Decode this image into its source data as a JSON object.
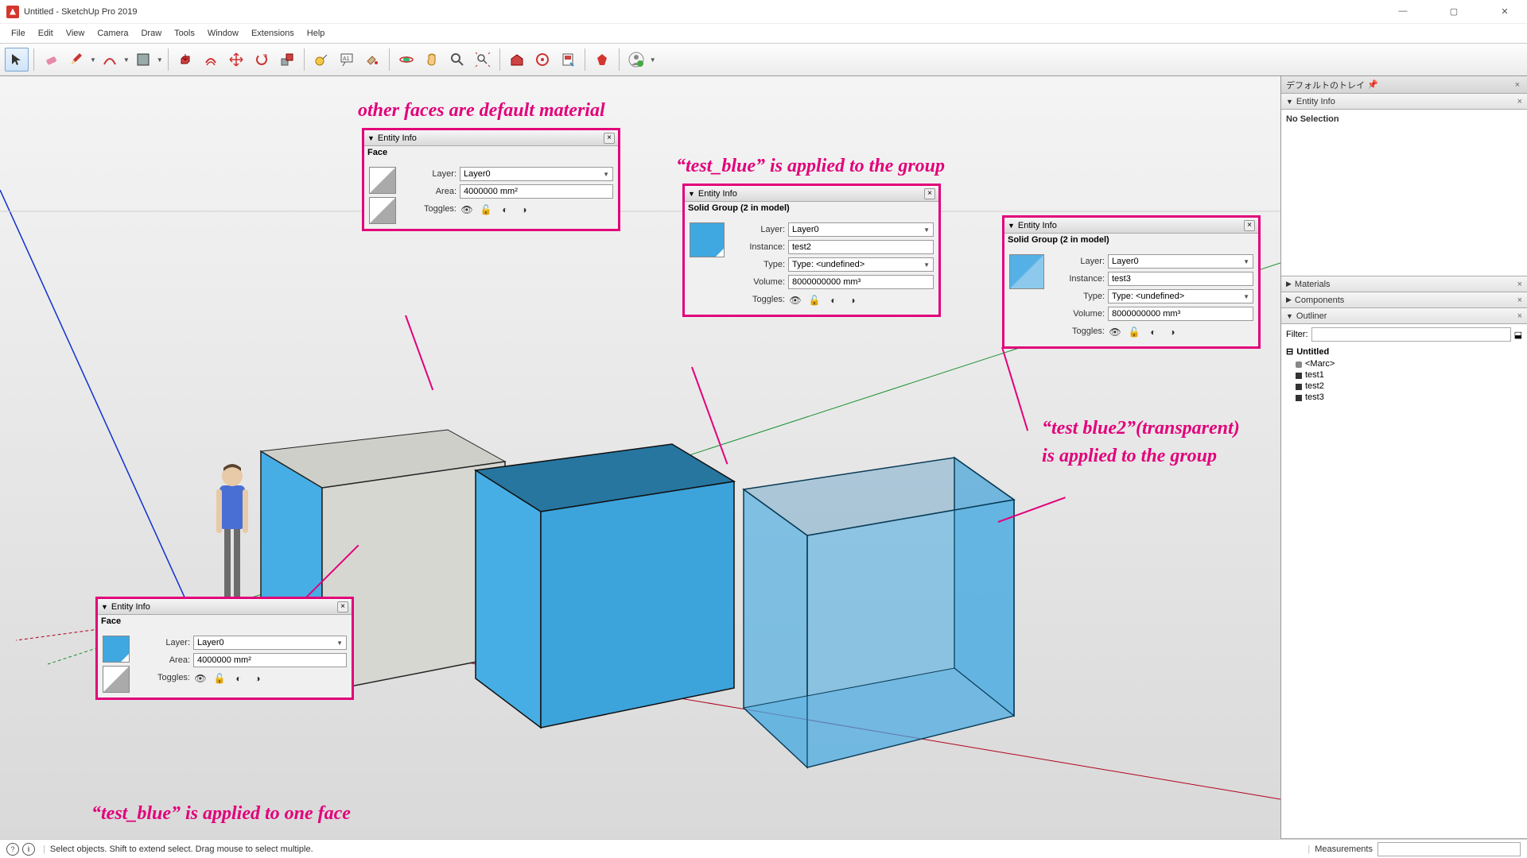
{
  "title": "Untitled - SketchUp Pro 2019",
  "menu": [
    "File",
    "Edit",
    "View",
    "Camera",
    "Draw",
    "Tools",
    "Window",
    "Extensions",
    "Help"
  ],
  "statusbar": {
    "hint": "Select objects. Shift to extend select. Drag mouse to select multiple.",
    "measure_label": "Measurements"
  },
  "tray": {
    "title": "デフォルトのトレイ",
    "entity_info": "Entity Info",
    "no_selection": "No Selection",
    "materials": "Materials",
    "components": "Components",
    "outliner": "Outliner",
    "filter_label": "Filter:",
    "root": "Untitled",
    "items": [
      {
        "label": "<Marc>",
        "cls": "marc"
      },
      {
        "label": "test1",
        "cls": ""
      },
      {
        "label": "test2",
        "cls": ""
      },
      {
        "label": "test3",
        "cls": ""
      }
    ]
  },
  "annotations": {
    "top": "other faces are default material",
    "right1": "“test_blue” is applied to the group",
    "right2a": "“test blue2”(transparent)",
    "right2b": "is applied to the group",
    "bottom": "“test_blue” is applied to one face"
  },
  "ei_a": {
    "title": "Entity Info",
    "header": "Face",
    "layer_label": "Layer:",
    "layer": "Layer0",
    "area_label": "Area:",
    "area": "4000000 mm²",
    "toggles_label": "Toggles:"
  },
  "ei_b": {
    "title": "Entity Info",
    "header": "Face",
    "layer_label": "Layer:",
    "layer": "Layer0",
    "area_label": "Area:",
    "area": "4000000 mm²",
    "toggles_label": "Toggles:"
  },
  "ei_c": {
    "title": "Entity Info",
    "header": "Solid Group (2 in model)",
    "layer_label": "Layer:",
    "layer": "Layer0",
    "instance_label": "Instance:",
    "instance": "test2",
    "type_label": "Type:",
    "type": "Type: <undefined>",
    "volume_label": "Volume:",
    "volume": "8000000000 mm³",
    "toggles_label": "Toggles:"
  },
  "ei_d": {
    "title": "Entity Info",
    "header": "Solid Group (2 in model)",
    "layer_label": "Layer:",
    "layer": "Layer0",
    "instance_label": "Instance:",
    "instance": "test3",
    "type_label": "Type:",
    "type": "Type: <undefined>",
    "volume_label": "Volume:",
    "volume": "8000000000 mm³",
    "toggles_label": "Toggles:"
  }
}
